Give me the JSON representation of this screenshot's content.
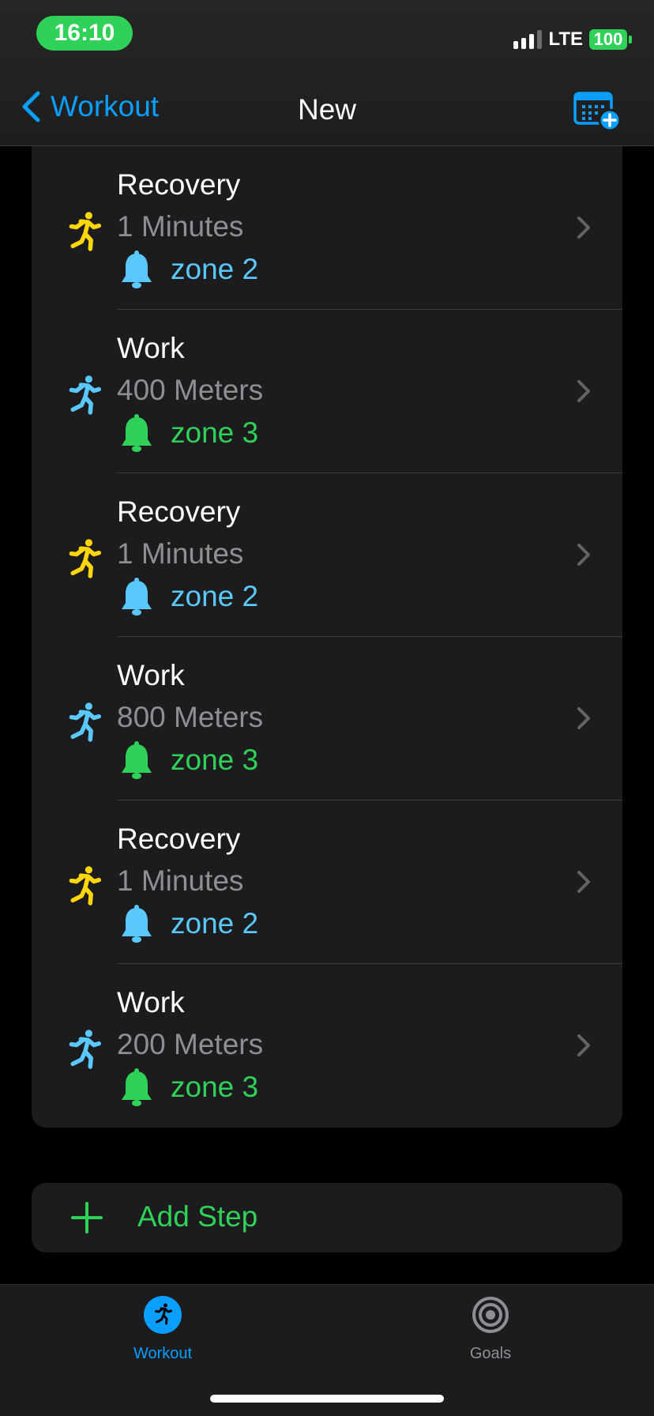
{
  "status": {
    "time": "16:10",
    "network": "LTE",
    "battery": "100"
  },
  "nav": {
    "back_label": "Workout",
    "title": "New",
    "action_icon": "calendar-add-icon"
  },
  "colors": {
    "accent": "#0a9fff",
    "green": "#30d158",
    "yellow": "#ffd60a",
    "light_blue": "#5ac8fa",
    "secondary_text": "#8e8e93"
  },
  "steps": [
    {
      "title": "Recovery",
      "detail": "1 Minutes",
      "zone": "zone 2",
      "type": "recovery"
    },
    {
      "title": "Work",
      "detail": "400 Meters",
      "zone": "zone 3",
      "type": "work"
    },
    {
      "title": "Recovery",
      "detail": "1 Minutes",
      "zone": "zone 2",
      "type": "recovery"
    },
    {
      "title": "Work",
      "detail": "800 Meters",
      "zone": "zone 3",
      "type": "work"
    },
    {
      "title": "Recovery",
      "detail": "1 Minutes",
      "zone": "zone 2",
      "type": "recovery"
    },
    {
      "title": "Work",
      "detail": "200 Meters",
      "zone": "zone 3",
      "type": "work"
    }
  ],
  "add_step": {
    "label": "Add Step"
  },
  "tabs": [
    {
      "label": "Workout",
      "icon": "running-figure-icon",
      "active": true
    },
    {
      "label": "Goals",
      "icon": "target-icon",
      "active": false
    }
  ]
}
